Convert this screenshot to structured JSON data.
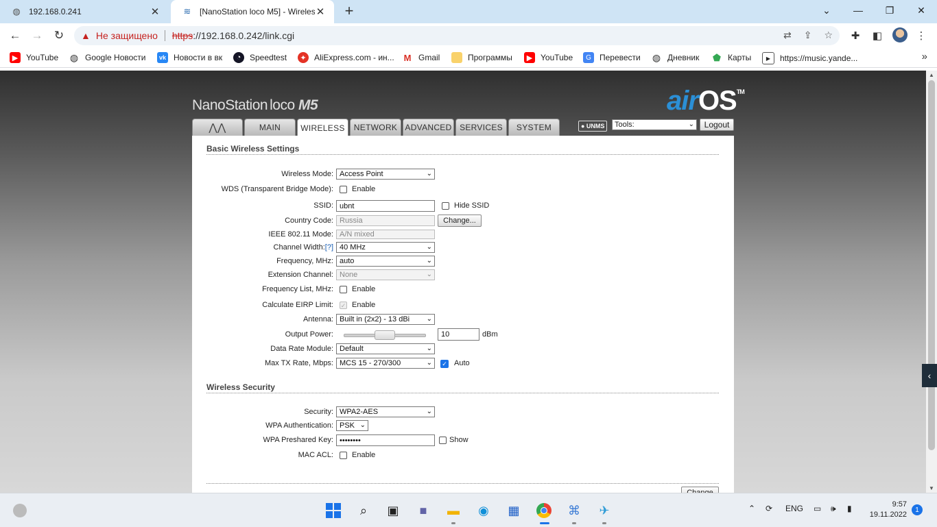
{
  "browser": {
    "tabs": [
      {
        "title": "192.168.0.241",
        "close": "✕"
      },
      {
        "title": "[NanoStation loco M5] - Wireless",
        "close": "✕"
      }
    ],
    "new_tab": "+",
    "window_controls": {
      "chevron": "⌄",
      "minimize": "—",
      "restore": "❐",
      "close": "✕"
    },
    "address": {
      "not_secure": "Не защищено",
      "url_protocol": "https",
      "url_rest": "://192.168.0.242/link.cgi"
    },
    "bookmarks": [
      {
        "label": "YouTube",
        "icon": "youtube-icon",
        "color": "#ff0000"
      },
      {
        "label": "Google Новости",
        "icon": "globe-icon",
        "color": "#333333"
      },
      {
        "label": "Новости в вк",
        "icon": "vk-icon",
        "color": "#2787f5"
      },
      {
        "label": "Speedtest",
        "icon": "speedtest-icon",
        "color": "#141526"
      },
      {
        "label": "AliExpress.com - ин...",
        "icon": "aliexpress-icon",
        "color": "#e43225"
      },
      {
        "label": "Gmail",
        "icon": "gmail-icon",
        "color": "#d93025"
      },
      {
        "label": "Программы",
        "icon": "folder-icon",
        "color": "#f9d26b"
      },
      {
        "label": "YouTube",
        "icon": "youtube-icon",
        "color": "#ff0000"
      },
      {
        "label": "Перевести",
        "icon": "translate-icon",
        "color": "#4285f4"
      },
      {
        "label": "Дневник",
        "icon": "globe-icon",
        "color": "#333333"
      },
      {
        "label": "Карты",
        "icon": "maps-icon",
        "color": "#34a853"
      },
      {
        "label": "https://music.yande...",
        "icon": "play-icon",
        "color": "#333333"
      }
    ],
    "bookmarks_more": "»"
  },
  "device": {
    "logo_name": "NanoStation",
    "logo_loco": "loco",
    "logo_model": "M5",
    "logo_air": "air",
    "logo_os": "OS",
    "logo_tm": "TM",
    "tabs": [
      "MAIN",
      "WIRELESS",
      "NETWORK",
      "ADVANCED",
      "SERVICES",
      "SYSTEM"
    ],
    "unms": "● UNMS",
    "tools_value": "Tools:",
    "logout": "Logout"
  },
  "basic": {
    "title": "Basic Wireless Settings",
    "wireless_mode": {
      "label": "Wireless Mode:",
      "value": "Access Point"
    },
    "wds": {
      "label": "WDS (Transparent Bridge Mode):",
      "text": "Enable",
      "checked": false
    },
    "ssid": {
      "label": "SSID:",
      "value": "ubnt",
      "hide_text": "Hide SSID"
    },
    "country": {
      "label": "Country Code:",
      "value": "Russia",
      "button": "Change..."
    },
    "ieee": {
      "label": "IEEE 802.11 Mode:",
      "value": "A/N mixed"
    },
    "channel_width": {
      "label": "Channel Width:",
      "help": "[?]",
      "value": "40 MHz"
    },
    "frequency": {
      "label": "Frequency, MHz:",
      "value": "auto"
    },
    "extension": {
      "label": "Extension Channel:",
      "value": "None"
    },
    "freq_list": {
      "label": "Frequency List, MHz:",
      "text": "Enable"
    },
    "eirp": {
      "label": "Calculate EIRP Limit:",
      "text": "Enable"
    },
    "antenna": {
      "label": "Antenna:",
      "value": "Built in (2x2) - 13 dBi"
    },
    "output_power": {
      "label": "Output Power:",
      "value": "10",
      "unit": "dBm",
      "level": 0.5
    },
    "data_rate": {
      "label": "Data Rate Module:",
      "value": "Default"
    },
    "max_tx": {
      "label": "Max TX Rate, Mbps:",
      "value": "MCS 15 - 270/300",
      "auto_text": "Auto"
    }
  },
  "security": {
    "title": "Wireless Security",
    "security": {
      "label": "Security:",
      "value": "WPA2-AES"
    },
    "wpa_auth": {
      "label": "WPA Authentication:",
      "value": "PSK"
    },
    "psk": {
      "label": "WPA Preshared Key:",
      "value": "••••••••",
      "show_text": "Show"
    },
    "mac_acl": {
      "label": "MAC ACL:",
      "text": "Enable"
    }
  },
  "change_button": "Change",
  "taskbar": {
    "lang": "ENG",
    "time": "9:57",
    "date": "19.11.2022",
    "notifications": "1"
  }
}
